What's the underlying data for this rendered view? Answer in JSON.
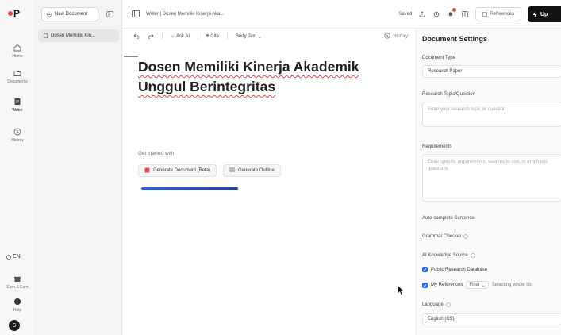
{
  "app": {
    "logo_text": "P"
  },
  "rail": {
    "items": [
      {
        "label": "Home",
        "icon": "home-icon"
      },
      {
        "label": "Documents",
        "icon": "folder-icon"
      },
      {
        "label": "Writer",
        "icon": "pen-icon"
      },
      {
        "label": "History",
        "icon": "clock-icon"
      }
    ],
    "lang": "EN",
    "earn_label": "Earn & Earn",
    "help_label": "Help",
    "avatar_initial": "S"
  },
  "docs_panel": {
    "new_button": "New Document",
    "items": [
      "Dosen Memiliki Kin..."
    ]
  },
  "topbar": {
    "breadcrumb_root": "Writer",
    "breadcrumb_doc": "Dosen Memiliki Kinerja Aka...",
    "saved": "Saved",
    "references": "References",
    "upgrade": "Up"
  },
  "toolbar": {
    "ask_ai": "Ask AI",
    "cite": "Cite",
    "style": "Body Text",
    "history": "History"
  },
  "editor": {
    "title_line1": "Dosen Memiliki Kinerja Akademik",
    "title_line2": "Unggul Berintegritas",
    "started": "Get started with:",
    "gen_doc": "Generate Document (Beta)",
    "gen_outline": "Generate Outline"
  },
  "settings": {
    "title": "Document Settings",
    "doc_type_label": "Document Type",
    "doc_type_value": "Research Paper",
    "topic_label": "Research Topic/Question",
    "topic_placeholder": "Enter your research topic or question",
    "requirements_label": "Requirements",
    "requirements_placeholder": "Enter specific requirements, sources to use, or emphasis questions",
    "autocomplete_label": "Auto-complete Sentence",
    "grammar_label": "Grammar Checker",
    "knowledge_label": "AI Knowledge Source",
    "public_db": "Public Research Database",
    "my_refs": "My References",
    "filter": "Filter",
    "selecting": "Selecting whole lib",
    "language_label": "Language",
    "language_value": "English (US)"
  },
  "colors": {
    "accent": "#2563eb",
    "brand_red": "#e5484d",
    "dark": "#111111"
  }
}
